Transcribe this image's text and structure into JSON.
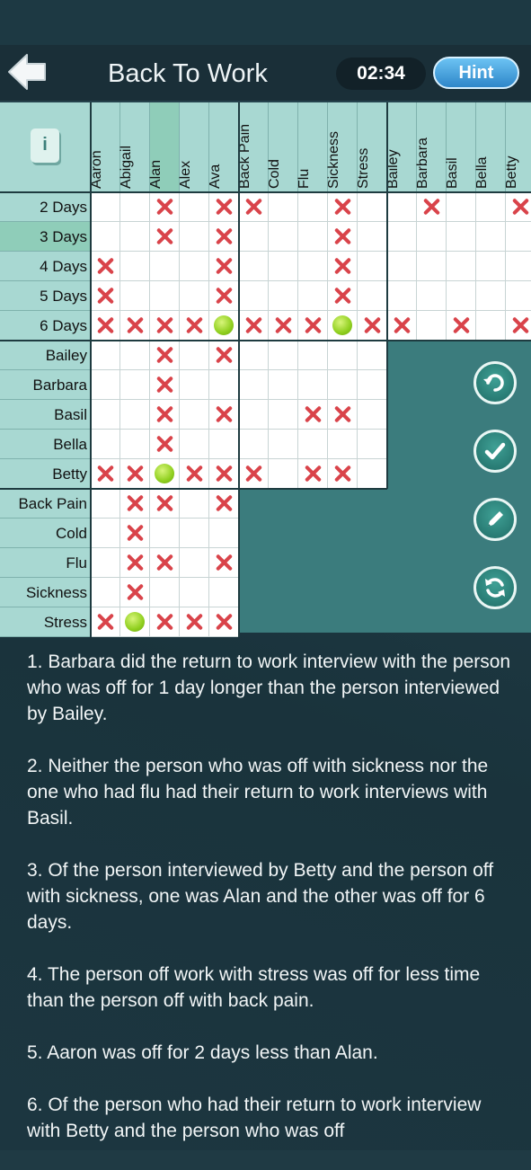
{
  "header": {
    "title": "Back To Work",
    "timer": "02:34",
    "hint_label": "Hint",
    "info_label": "i"
  },
  "columns": [
    "Aaron",
    "Abigail",
    "Alan",
    "Alex",
    "Ava",
    "Back Pain",
    "Cold",
    "Flu",
    "Sickness",
    "Stress",
    "Bailey",
    "Barbara",
    "Basil",
    "Bella",
    "Betty"
  ],
  "rows": [
    "2 Days",
    "3 Days",
    "4 Days",
    "5 Days",
    "6 Days",
    "Bailey",
    "Barbara",
    "Basil",
    "Bella",
    "Betty",
    "Back Pain",
    "Cold",
    "Flu",
    "Sickness",
    "Stress"
  ],
  "grid_marks": {
    "2 Days": [
      "",
      "",
      "X",
      "",
      "X",
      "X",
      "",
      "",
      "X",
      "",
      "",
      "X",
      "",
      "",
      "X"
    ],
    "3 Days": [
      "",
      "",
      "X",
      "",
      "X",
      "",
      "",
      "",
      "X",
      "",
      "",
      "",
      "",
      "",
      ""
    ],
    "4 Days": [
      "X",
      "",
      "",
      "",
      "X",
      "",
      "",
      "",
      "X",
      "",
      "",
      "",
      "",
      "",
      ""
    ],
    "5 Days": [
      "X",
      "",
      "",
      "",
      "X",
      "",
      "",
      "",
      "X",
      "",
      "",
      "",
      "",
      "",
      ""
    ],
    "6 Days": [
      "X",
      "X",
      "X",
      "X",
      "O",
      "X",
      "X",
      "X",
      "O",
      "X",
      "X",
      "",
      "X",
      "",
      "X"
    ],
    "Bailey": [
      "",
      "",
      "X",
      "",
      "X",
      "",
      "",
      "",
      "",
      ""
    ],
    "Barbara": [
      "",
      "",
      "X",
      "",
      "",
      "",
      "",
      "",
      "",
      ""
    ],
    "Basil": [
      "",
      "",
      "X",
      "",
      "X",
      "",
      "",
      "X",
      "X",
      ""
    ],
    "Bella": [
      "",
      "",
      "X",
      "",
      "",
      "",
      "",
      "",
      "",
      ""
    ],
    "Betty": [
      "X",
      "X",
      "O",
      "X",
      "X",
      "X",
      "",
      "X",
      "X",
      ""
    ],
    "Back Pain": [
      "",
      "X",
      "X",
      "",
      "X"
    ],
    "Cold": [
      "",
      "X",
      "",
      "",
      ""
    ],
    "Flu": [
      "",
      "X",
      "X",
      "",
      "X"
    ],
    "Sickness": [
      "",
      "X",
      "",
      "",
      ""
    ],
    "Stress": [
      "X",
      "O",
      "X",
      "X",
      "X"
    ]
  },
  "side_buttons": [
    "undo-icon",
    "check-icon",
    "pencil-icon",
    "refresh-icon"
  ],
  "clues": [
    "1. Barbara did the return to work interview with the person who was off for 1 day longer than the person interviewed by Bailey.",
    "2. Neither the person who was off with sickness nor the one who had flu had their return to work interviews with Basil.",
    "3. Of the person interviewed by Betty and the person off with sickness, one was Alan and the other was off for 6 days.",
    "4. The person off work with stress was off for less time than the person off with back pain.",
    "5. Aaron was off for 2 days less than Alan.",
    "6. Of the person who had their return to work interview with Betty and the person who was off"
  ],
  "colors": {
    "x_mark": "#d9434a",
    "circle_mark": "#8fcf1e",
    "header_cells": "#a8d8d2",
    "board_bg": "#3b7c7d",
    "hint_button": "#2e86c9"
  }
}
